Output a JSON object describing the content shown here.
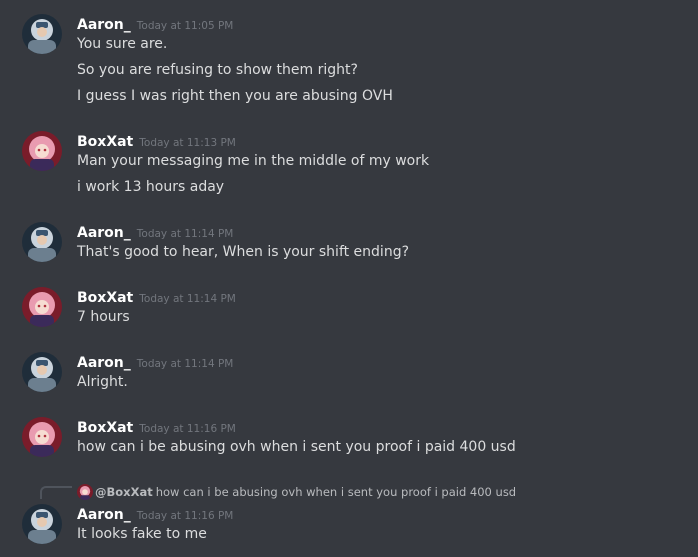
{
  "messages": [
    {
      "author": "Aaron_",
      "timestamp": "Today at 11:05 PM",
      "avatar": "aaron-avatar",
      "lines": [
        "You sure are.",
        "So you are refusing to show them right?",
        "I guess I was right then you are abusing OVH"
      ]
    },
    {
      "author": "BoxXat",
      "timestamp": "Today at 11:13 PM",
      "avatar": "boxxat-avatar",
      "lines": [
        "Man your messaging me in the middle of my work",
        "i work 13 hours aday"
      ]
    },
    {
      "author": "Aaron_",
      "timestamp": "Today at 11:14 PM",
      "avatar": "aaron-avatar",
      "lines": [
        "That's good to hear, When is your shift ending?"
      ]
    },
    {
      "author": "BoxXat",
      "timestamp": "Today at 11:14 PM",
      "avatar": "boxxat-avatar",
      "lines": [
        "7 hours"
      ]
    },
    {
      "author": "Aaron_",
      "timestamp": "Today at 11:14 PM",
      "avatar": "aaron-avatar",
      "lines": [
        "Alright."
      ]
    },
    {
      "author": "BoxXat",
      "timestamp": "Today at 11:16 PM",
      "avatar": "boxxat-avatar",
      "lines": [
        "how can i be abusing ovh when i sent you proof i paid 400 usd"
      ]
    },
    {
      "author": "Aaron_",
      "timestamp": "Today at 11:16 PM",
      "avatar": "aaron-avatar",
      "lines": [
        "It looks fake to me"
      ]
    }
  ],
  "reply": {
    "mention": "@BoxXat",
    "text": "how can i be abusing ovh when i sent you proof i paid 400 usd"
  },
  "colors": {
    "background": "#36393f",
    "username": "#ffffff",
    "message_text": "#dcddde",
    "timestamp": "#72767d",
    "reply_text": "#b9bbbe"
  }
}
